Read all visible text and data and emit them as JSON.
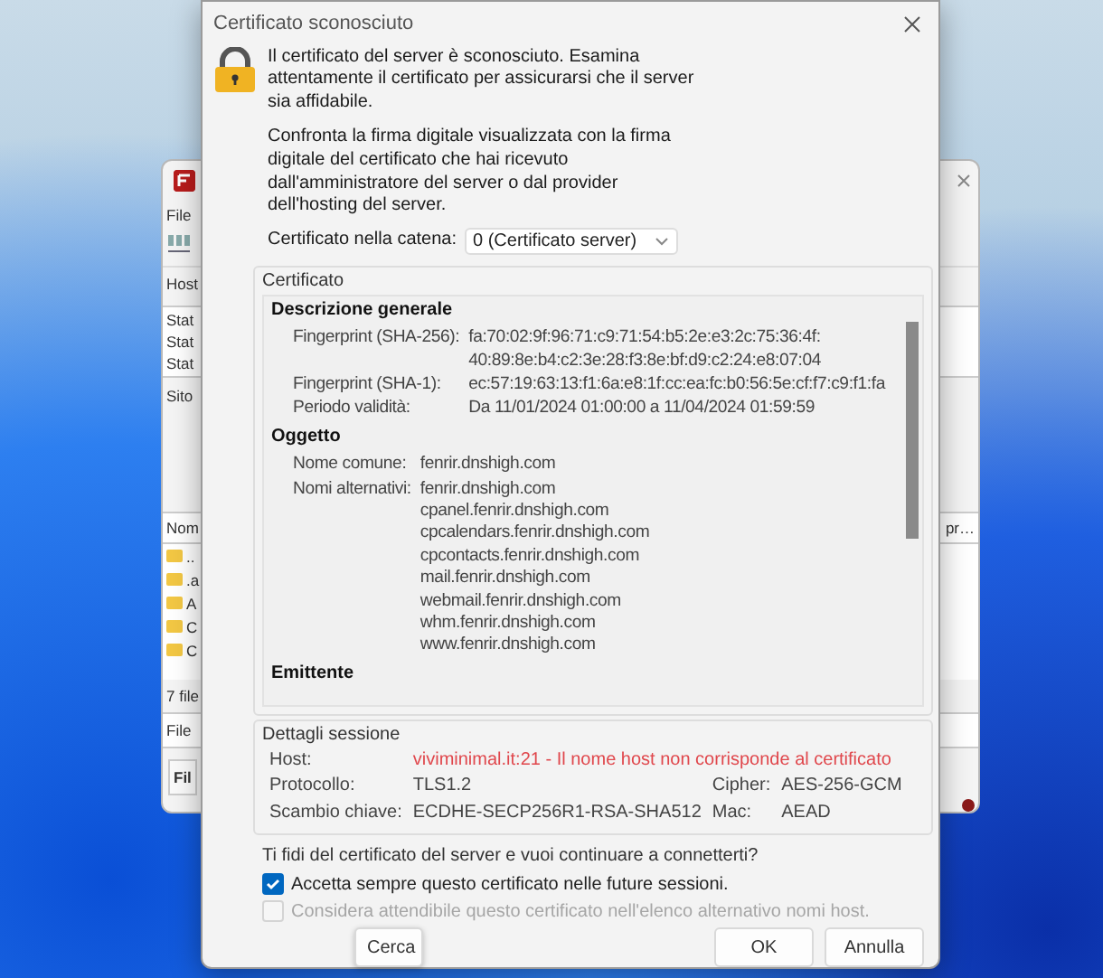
{
  "background_window": {
    "menu": "File",
    "host_label": "Host",
    "log_lines": [
      "Stat",
      "Stat",
      "Stat"
    ],
    "site_label": "Sito",
    "list_header": "Nom",
    "right_header": "pr…",
    "files": [
      "..",
      ".a",
      "A",
      "C",
      "C"
    ],
    "file_count": "7 file",
    "queue_label": "File",
    "tab": "Fil"
  },
  "dialog": {
    "title": "Certificato sconosciuto",
    "intro": "Il certificato del server è sconosciuto. Esamina attentamente il certificato per assicurarsi che il server sia affidabile.",
    "instructions": "Confronta la firma digitale visualizzata con la firma digitale del certificato che hai ricevuto dall'amministratore del server o dal provider dell'hosting del server.",
    "chain": {
      "label": "Certificato nella catena:",
      "value": "0 (Certificato server)"
    },
    "certificate": {
      "legend": "Certificato",
      "sections": [
        {
          "heading": "Descrizione generale",
          "fields": [
            {
              "label": "Fingerprint (SHA-256):",
              "values": [
                "fa:70:02:9f:96:71:c9:71:54:b5:2e:e3:2c:75:36:4f:",
                "40:89:8e:b4:c2:3e:28:f3:8e:bf:d9:c2:24:e8:07:04"
              ]
            },
            {
              "label": "Fingerprint (SHA-1):",
              "values": [
                "ec:57:19:63:13:f1:6a:e8:1f:cc:ea:fc:b0:56:5e:cf:f7:c9:f1:fa"
              ]
            },
            {
              "label": "Periodo validità:",
              "values": [
                "Da 11/01/2024 01:00:00 a 11/04/2024 01:59:59"
              ]
            }
          ]
        },
        {
          "heading": "Oggetto",
          "fields": [
            {
              "label": "Nome comune:",
              "values": [
                "fenrir.dnshigh.com"
              ]
            },
            {
              "label": "Nomi alternativi:",
              "values": [
                "fenrir.dnshigh.com",
                "cpanel.fenrir.dnshigh.com",
                "cpcalendars.fenrir.dnshigh.com",
                "cpcontacts.fenrir.dnshigh.com",
                "mail.fenrir.dnshigh.com",
                "webmail.fenrir.dnshigh.com",
                "whm.fenrir.dnshigh.com",
                "www.fenrir.dnshigh.com"
              ]
            }
          ]
        },
        {
          "heading": "Emittente"
        }
      ]
    },
    "session": {
      "legend": "Dettagli sessione",
      "rows": [
        [
          {
            "label": "Host:",
            "value": "viviminimal.it:21 - Il nome host non corrisponde al certificato",
            "warning": true
          }
        ],
        [
          {
            "label": "Protocollo:",
            "value": "TLS1.2",
            "warning": false
          },
          {
            "label": "Cipher:",
            "value": "AES-256-GCM",
            "warning": false
          }
        ],
        [
          {
            "label": "Scambio chiave:",
            "value": "ECDHE-SECP256R1-RSA-SHA512",
            "warning": false
          },
          {
            "label": "Mac:",
            "value": "AEAD",
            "warning": false
          }
        ]
      ]
    },
    "question": "Ti fidi del certificato del server e vuoi continuare a connetterti?",
    "options": [
      {
        "label": "Accetta sempre questo certificato nelle future sessioni.",
        "checked": true,
        "disabled": false
      },
      {
        "label": "Considera attendibile questo certificato nell'elenco alternativo nomi host.",
        "checked": false,
        "disabled": true
      }
    ],
    "search_button": "Cerca",
    "buttons": [
      "OK",
      "Annulla"
    ]
  }
}
